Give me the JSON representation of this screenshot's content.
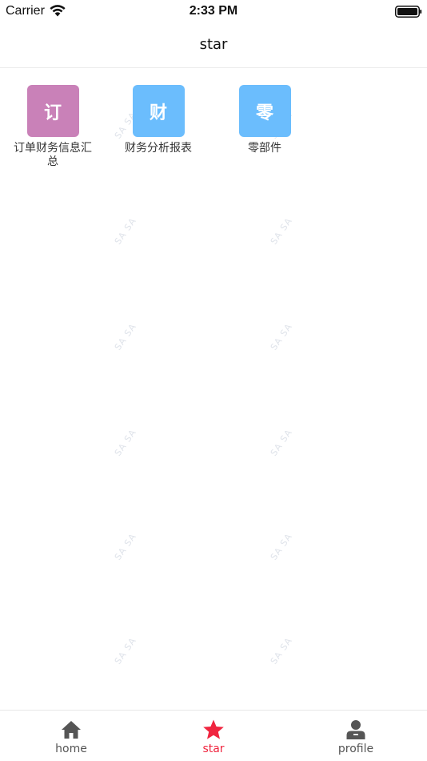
{
  "status_bar": {
    "carrier": "Carrier",
    "time": "2:33 PM"
  },
  "nav": {
    "title": "star"
  },
  "grid": {
    "items": [
      {
        "glyph": "订",
        "label": "订单财务信息汇总",
        "color": "#c981b8",
        "icon": "order-icon"
      },
      {
        "glyph": "财",
        "label": "财务分析报表",
        "color": "#6bbdfd",
        "icon": "finance-icon"
      },
      {
        "glyph": "零",
        "label": "零部件",
        "color": "#6bbdfd",
        "icon": "parts-icon"
      }
    ]
  },
  "watermark": "SA SA",
  "tab_bar": {
    "tabs": [
      {
        "label": "home",
        "icon": "home-icon",
        "active": false
      },
      {
        "label": "star",
        "icon": "star-icon",
        "active": true
      },
      {
        "label": "profile",
        "icon": "profile-icon",
        "active": false
      }
    ],
    "active_color": "#f0253f",
    "inactive_color": "#555555"
  }
}
